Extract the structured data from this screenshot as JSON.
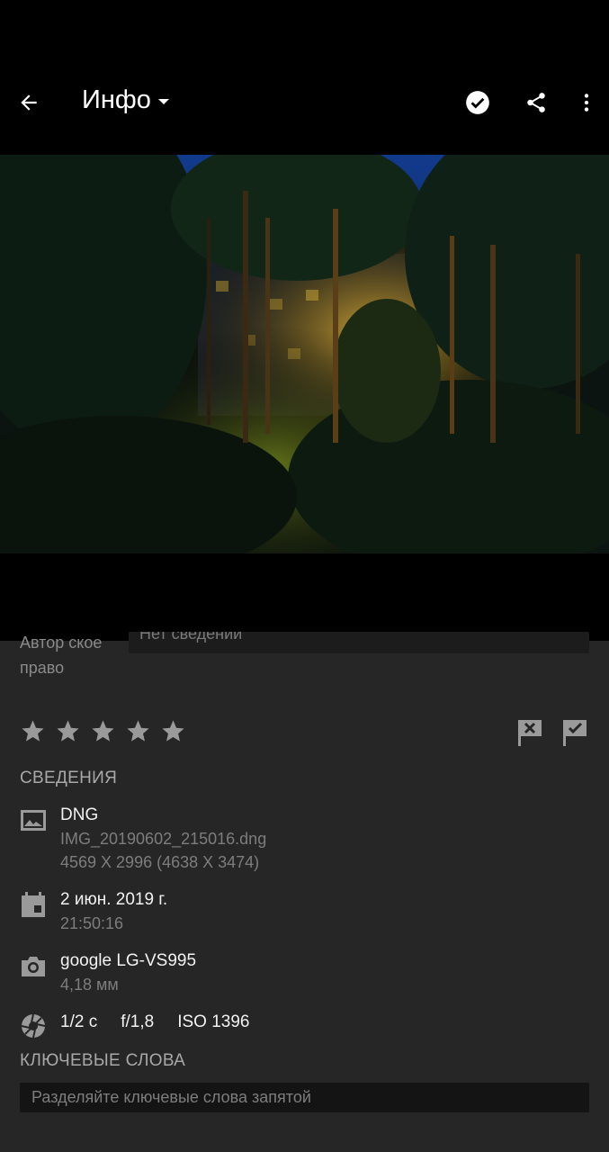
{
  "header": {
    "title": "Инфо",
    "back_icon": "arrow-left-icon",
    "actions": [
      "check-circle-icon",
      "share-icon",
      "more-vertical-icon"
    ]
  },
  "photo": {
    "description_icon": "photo"
  },
  "copyright": {
    "label": "Автор ское право",
    "value": "Нет сведений"
  },
  "rating": {
    "stars": 5,
    "filled": 0,
    "reject_icon": "flag-reject-icon",
    "pick_icon": "flag-pick-icon"
  },
  "details": {
    "section_title": "СВЕДЕНИЯ",
    "file": {
      "icon": "image-icon",
      "format": "DNG",
      "filename": "IMG_20190602_215016.dng",
      "dimensions": "4569 X 2996 (4638 X 3474)"
    },
    "date": {
      "icon": "calendar-icon",
      "date": "2 июн. 2019 г.",
      "time": "21:50:16"
    },
    "camera": {
      "icon": "camera-icon",
      "model": "google LG-VS995",
      "focal_length": "4,18 мм"
    },
    "exposure": {
      "icon": "aperture-icon",
      "shutter": "1/2 с",
      "aperture": "f/1,8",
      "iso": "ISO 1396"
    }
  },
  "keywords": {
    "section_title": "КЛЮЧЕВЫЕ СЛОВА",
    "placeholder": "Разделяйте ключевые слова запятой"
  },
  "colors": {
    "background": "#262626",
    "topbar": "#000000",
    "text_primary": "#f2f2f2",
    "text_secondary": "#7d7d7d",
    "icon": "#9a9a9a"
  }
}
